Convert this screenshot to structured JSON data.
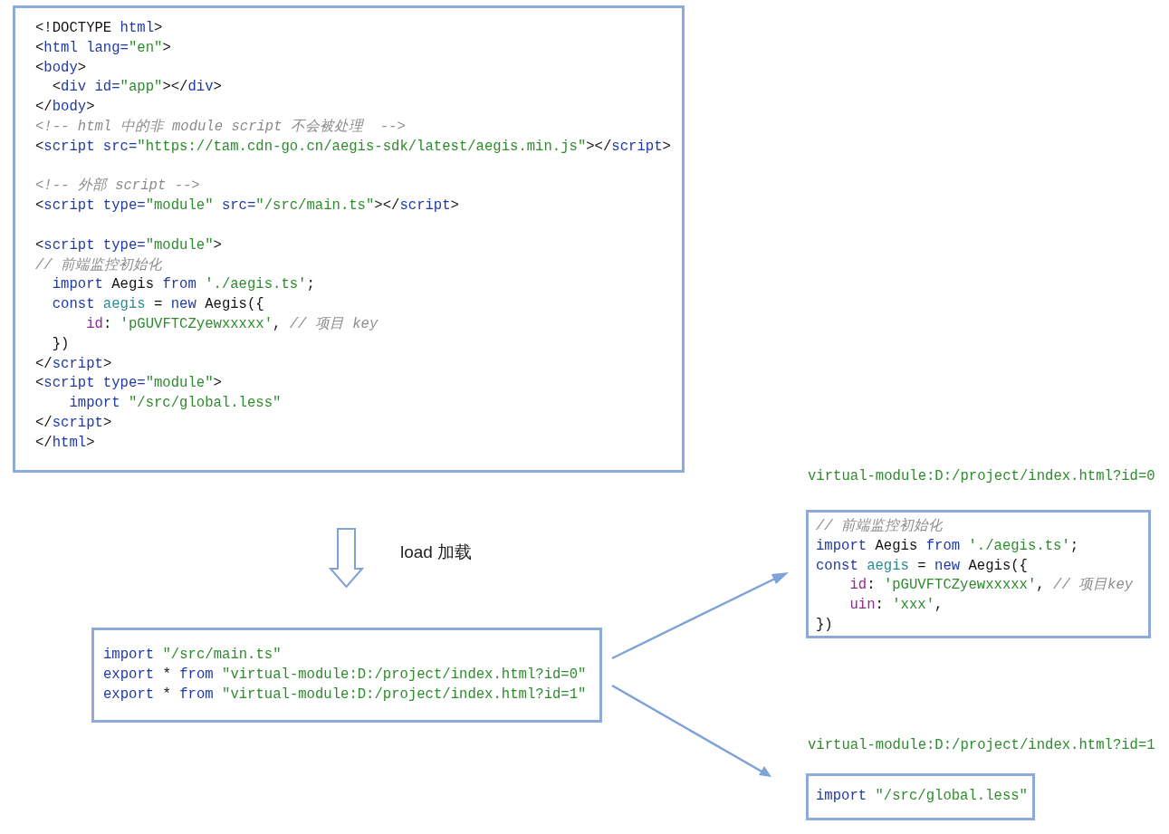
{
  "main_code": {
    "lines": [
      {
        "gap": false,
        "tokens": [
          {
            "kind": "txt",
            "s": "<!DOCTYPE "
          },
          {
            "kind": "tag",
            "s": "html"
          },
          {
            "kind": "txt",
            "s": ">"
          }
        ]
      },
      {
        "gap": false,
        "tokens": [
          {
            "kind": "txt",
            "s": "<"
          },
          {
            "kind": "tag",
            "s": "html lang="
          },
          {
            "kind": "str",
            "s": "\"en\""
          },
          {
            "kind": "txt",
            "s": ">"
          }
        ]
      },
      {
        "gap": false,
        "tokens": [
          {
            "kind": "txt",
            "s": "<"
          },
          {
            "kind": "tag",
            "s": "body"
          },
          {
            "kind": "txt",
            "s": ">"
          }
        ]
      },
      {
        "gap": false,
        "tokens": [
          {
            "kind": "txt",
            "s": "  <"
          },
          {
            "kind": "tag",
            "s": "div id="
          },
          {
            "kind": "str",
            "s": "\"app\""
          },
          {
            "kind": "txt",
            "s": "></"
          },
          {
            "kind": "tag",
            "s": "div"
          },
          {
            "kind": "txt",
            "s": ">"
          }
        ]
      },
      {
        "gap": false,
        "tokens": [
          {
            "kind": "txt",
            "s": "</"
          },
          {
            "kind": "tag",
            "s": "body"
          },
          {
            "kind": "txt",
            "s": ">"
          }
        ]
      },
      {
        "gap": false,
        "tokens": [
          {
            "kind": "cmt",
            "s": "<!-- html 中的非 module script 不会被处理  -->"
          }
        ]
      },
      {
        "gap": false,
        "tokens": [
          {
            "kind": "txt",
            "s": "<"
          },
          {
            "kind": "tag",
            "s": "script src="
          },
          {
            "kind": "str",
            "s": "\"https://tam.cdn-go.cn/aegis-sdk/latest/aegis.min.js\""
          },
          {
            "kind": "txt",
            "s": "></"
          },
          {
            "kind": "tag",
            "s": "script"
          },
          {
            "kind": "txt",
            "s": ">"
          }
        ]
      },
      {
        "gap": true,
        "tokens": [
          {
            "kind": "cmt",
            "s": "<!-- 外部 script -->"
          }
        ]
      },
      {
        "gap": false,
        "tokens": [
          {
            "kind": "txt",
            "s": "<"
          },
          {
            "kind": "tag",
            "s": "script type="
          },
          {
            "kind": "str",
            "s": "\"module\""
          },
          {
            "kind": "tag",
            "s": " src="
          },
          {
            "kind": "str",
            "s": "\"/src/main.ts\""
          },
          {
            "kind": "txt",
            "s": "></"
          },
          {
            "kind": "tag",
            "s": "script"
          },
          {
            "kind": "txt",
            "s": ">"
          }
        ]
      },
      {
        "gap": true,
        "tokens": [
          {
            "kind": "txt",
            "s": "<"
          },
          {
            "kind": "tag",
            "s": "script type="
          },
          {
            "kind": "str",
            "s": "\"module\""
          },
          {
            "kind": "txt",
            "s": ">"
          }
        ]
      },
      {
        "gap": false,
        "tokens": [
          {
            "kind": "cmt",
            "s": "// 前端监控初始化"
          }
        ]
      },
      {
        "gap": false,
        "tokens": [
          {
            "kind": "kw",
            "s": "  import"
          },
          {
            "kind": "txt",
            "s": " Aegis "
          },
          {
            "kind": "kw",
            "s": "from"
          },
          {
            "kind": "str",
            "s": " './aegis.ts'"
          },
          {
            "kind": "txt",
            "s": ";"
          }
        ]
      },
      {
        "gap": false,
        "tokens": [
          {
            "kind": "kw",
            "s": "  const"
          },
          {
            "kind": "var",
            "s": " aegis"
          },
          {
            "kind": "txt",
            "s": " = "
          },
          {
            "kind": "kw",
            "s": "new"
          },
          {
            "kind": "txt",
            "s": " Aegis({"
          }
        ]
      },
      {
        "gap": false,
        "tokens": [
          {
            "kind": "prop",
            "s": "      id"
          },
          {
            "kind": "txt",
            "s": ": "
          },
          {
            "kind": "str",
            "s": "'pGUVFTCZyewxxxxx'"
          },
          {
            "kind": "txt",
            "s": ", "
          },
          {
            "kind": "cmt",
            "s": "// 项目 key"
          }
        ]
      },
      {
        "gap": false,
        "tokens": [
          {
            "kind": "txt",
            "s": "  })"
          }
        ]
      },
      {
        "gap": false,
        "tokens": [
          {
            "kind": "txt",
            "s": "</"
          },
          {
            "kind": "tag",
            "s": "script"
          },
          {
            "kind": "txt",
            "s": ">"
          }
        ]
      },
      {
        "gap": false,
        "tokens": [
          {
            "kind": "txt",
            "s": "<"
          },
          {
            "kind": "tag",
            "s": "script type="
          },
          {
            "kind": "str",
            "s": "\"module\""
          },
          {
            "kind": "txt",
            "s": ">"
          }
        ]
      },
      {
        "gap": false,
        "tokens": [
          {
            "kind": "kw",
            "s": "    import"
          },
          {
            "kind": "str",
            "s": " \"/src/global.less\""
          }
        ]
      },
      {
        "gap": false,
        "tokens": [
          {
            "kind": "txt",
            "s": "</"
          },
          {
            "kind": "tag",
            "s": "script"
          },
          {
            "kind": "txt",
            "s": ">"
          }
        ]
      },
      {
        "gap": false,
        "tokens": [
          {
            "kind": "txt",
            "s": "</"
          },
          {
            "kind": "tag",
            "s": "html"
          },
          {
            "kind": "txt",
            "s": ">"
          }
        ]
      }
    ]
  },
  "load_label": "load 加载",
  "entry_code": {
    "lines": [
      {
        "gap": false,
        "tokens": [
          {
            "kind": "kw",
            "s": "import"
          },
          {
            "kind": "str",
            "s": " \"/src/main.ts\""
          }
        ]
      },
      {
        "gap": false,
        "tokens": [
          {
            "kind": "kw",
            "s": "export"
          },
          {
            "kind": "txt",
            "s": " * "
          },
          {
            "kind": "kw",
            "s": "from"
          },
          {
            "kind": "str",
            "s": " \"virtual-module:D:/project/index.html?id=0\""
          }
        ]
      },
      {
        "gap": false,
        "tokens": [
          {
            "kind": "kw",
            "s": "export"
          },
          {
            "kind": "txt",
            "s": " * "
          },
          {
            "kind": "kw",
            "s": "from"
          },
          {
            "kind": "str",
            "s": " \"virtual-module:D:/project/index.html?id=1\""
          }
        ]
      }
    ]
  },
  "virtual_modules": [
    {
      "label": "virtual-module:D:/project/index.html?id=0",
      "lines": [
        {
          "gap": false,
          "tokens": [
            {
              "kind": "cmt",
              "s": "// 前端监控初始化"
            }
          ]
        },
        {
          "gap": false,
          "tokens": [
            {
              "kind": "kw",
              "s": "import"
            },
            {
              "kind": "txt",
              "s": " Aegis "
            },
            {
              "kind": "kw",
              "s": "from"
            },
            {
              "kind": "str",
              "s": " './aegis.ts'"
            },
            {
              "kind": "txt",
              "s": ";"
            }
          ]
        },
        {
          "gap": false,
          "tokens": [
            {
              "kind": "kw",
              "s": "const"
            },
            {
              "kind": "var",
              "s": " aegis"
            },
            {
              "kind": "txt",
              "s": " = "
            },
            {
              "kind": "kw",
              "s": "new"
            },
            {
              "kind": "txt",
              "s": " Aegis({"
            }
          ]
        },
        {
          "gap": false,
          "tokens": [
            {
              "kind": "prop",
              "s": "    id"
            },
            {
              "kind": "txt",
              "s": ": "
            },
            {
              "kind": "str",
              "s": "'pGUVFTCZyewxxxxx'"
            },
            {
              "kind": "txt",
              "s": ", "
            },
            {
              "kind": "cmt",
              "s": "// 项目key"
            }
          ]
        },
        {
          "gap": false,
          "tokens": [
            {
              "kind": "prop",
              "s": "    uin"
            },
            {
              "kind": "txt",
              "s": ": "
            },
            {
              "kind": "str",
              "s": "'xxx'"
            },
            {
              "kind": "txt",
              "s": ","
            }
          ]
        },
        {
          "gap": false,
          "tokens": [
            {
              "kind": "txt",
              "s": "})"
            }
          ]
        }
      ]
    },
    {
      "label": "virtual-module:D:/project/index.html?id=1",
      "lines": [
        {
          "gap": false,
          "tokens": [
            {
              "kind": "kw",
              "s": "import"
            },
            {
              "kind": "str",
              "s": " \"/src/global.less\""
            }
          ]
        }
      ]
    }
  ]
}
